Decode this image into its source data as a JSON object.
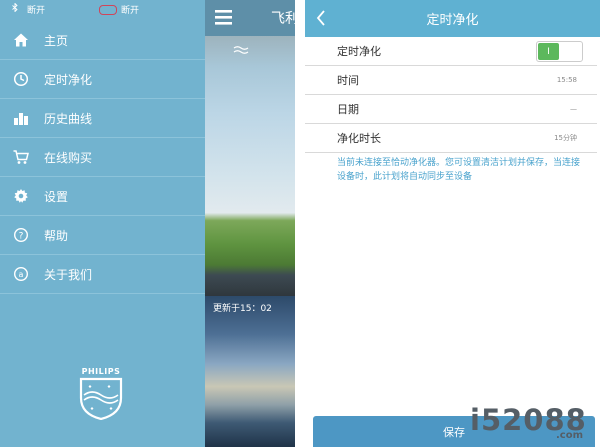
{
  "status_bar": {
    "bluetooth": "断开",
    "battery": "断开"
  },
  "menu": [
    {
      "label": "主页",
      "icon": "home-icon"
    },
    {
      "label": "定时净化",
      "icon": "clock-icon"
    },
    {
      "label": "历史曲线",
      "icon": "chart-icon"
    },
    {
      "label": "在线购买",
      "icon": "cart-icon"
    },
    {
      "label": "设置",
      "icon": "gear-icon"
    },
    {
      "label": "帮助",
      "icon": "help-icon"
    },
    {
      "label": "关于我们",
      "icon": "info-icon"
    }
  ],
  "brand": "PHILIPS",
  "side": {
    "title": "飞利",
    "updated": "更新于15：02"
  },
  "right": {
    "title": "定时净化",
    "rows": [
      {
        "label": "定时净化",
        "value": "",
        "toggle": true
      },
      {
        "label": "时间",
        "value": "15:58"
      },
      {
        "label": "日期",
        "value": "—"
      },
      {
        "label": "净化时长",
        "value": "15分钟"
      }
    ],
    "toggle_text": "I",
    "note": "当前未连接至恰动净化器。您可设置清洁计划并保存，当连接设备时，此计划将自动同步至设备",
    "save": "保存"
  },
  "watermark": {
    "main": "i52088",
    "sub": ".com"
  },
  "colors": {
    "drawer": "#72b3cf",
    "header": "#5fb1d2",
    "accent": "#4d97c4",
    "toggle_on": "#5cb85c"
  }
}
